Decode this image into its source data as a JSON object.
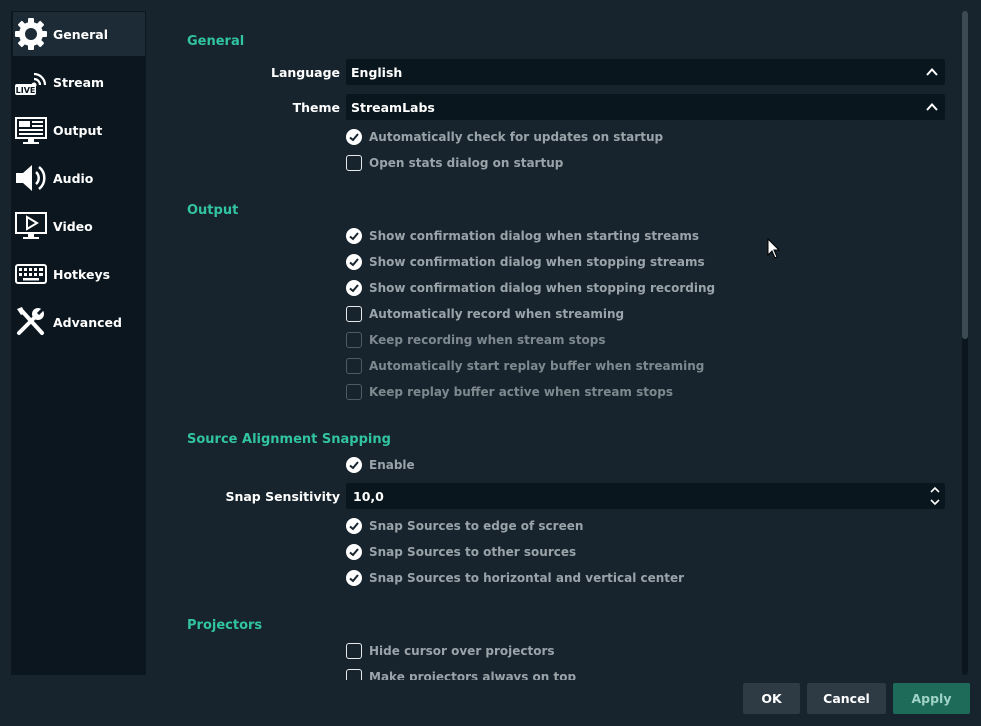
{
  "sidebar": {
    "items": [
      {
        "label": "General",
        "icon": "gear-icon"
      },
      {
        "label": "Stream",
        "icon": "live-stream-icon"
      },
      {
        "label": "Output",
        "icon": "output-icon"
      },
      {
        "label": "Audio",
        "icon": "speaker-icon"
      },
      {
        "label": "Video",
        "icon": "monitor-play-icon"
      },
      {
        "label": "Hotkeys",
        "icon": "keyboard-icon"
      },
      {
        "label": "Advanced",
        "icon": "tools-icon"
      }
    ],
    "active": "General"
  },
  "general": {
    "title": "General",
    "language_label": "Language",
    "language_value": "English",
    "theme_label": "Theme",
    "theme_value": "StreamLabs",
    "check_updates": {
      "label": "Automatically check for updates on startup",
      "checked": true
    },
    "open_stats": {
      "label": "Open stats dialog on startup",
      "checked": false
    }
  },
  "output": {
    "title": "Output",
    "items": [
      {
        "label": "Show confirmation dialog when starting streams",
        "checked": true
      },
      {
        "label": "Show confirmation dialog when stopping streams",
        "checked": true
      },
      {
        "label": "Show confirmation dialog when stopping recording",
        "checked": true
      },
      {
        "label": "Automatically record when streaming",
        "checked": false
      },
      {
        "label": "Keep recording when stream stops",
        "checked": false,
        "disabled": true
      },
      {
        "label": "Automatically start replay buffer when streaming",
        "checked": false,
        "disabled": true
      },
      {
        "label": "Keep replay buffer active when stream stops",
        "checked": false,
        "disabled": true
      }
    ]
  },
  "snapping": {
    "title": "Source Alignment Snapping",
    "enable": {
      "label": "Enable",
      "checked": true
    },
    "sensitivity_label": "Snap Sensitivity",
    "sensitivity_value": "10,0",
    "items": [
      {
        "label": "Snap Sources to edge of screen",
        "checked": true
      },
      {
        "label": "Snap Sources to other sources",
        "checked": true
      },
      {
        "label": "Snap Sources to horizontal and vertical center",
        "checked": true
      }
    ]
  },
  "projectors": {
    "title": "Projectors",
    "items": [
      {
        "label": "Hide cursor over projectors",
        "checked": false
      },
      {
        "label": "Make projectors always on top",
        "checked": false
      }
    ]
  },
  "buttons": {
    "ok": "OK",
    "cancel": "Cancel",
    "apply": "Apply"
  },
  "colors": {
    "accent": "#31c3a2",
    "background": "#17242d",
    "panel": "#0b161e",
    "apply": "#1f6b5a"
  }
}
